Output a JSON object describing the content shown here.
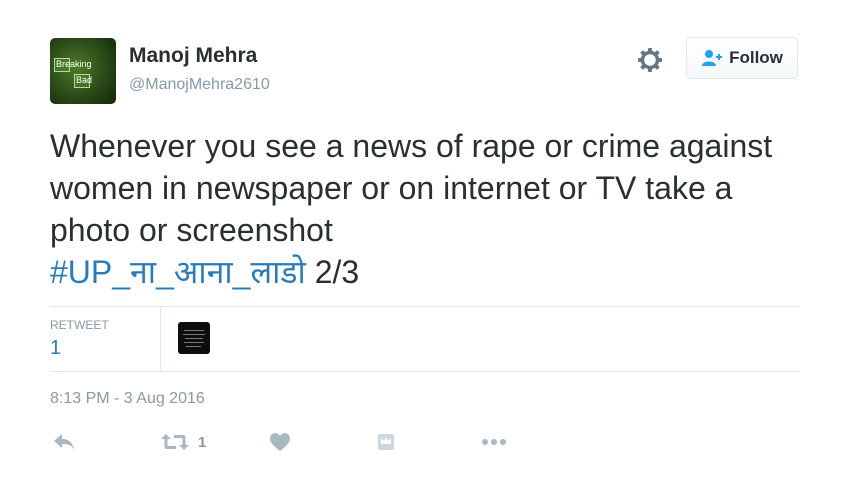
{
  "user": {
    "name": "Manoj Mehra",
    "handle": "@ManojMehra2610",
    "avatar_text_1": "Br",
    "avatar_text_2": "eaking",
    "avatar_text_3": "Ba",
    "avatar_text_4": "d"
  },
  "header": {
    "follow_label": "Follow",
    "gear_icon": "gear-icon",
    "follow_icon": "add-person-icon"
  },
  "tweet": {
    "text": "Whenever you see a news of rape or crime against women in newspaper or on internet or TV take a photo or screenshot",
    "hashtag": "#UP_ना_आना_लाडो",
    "suffix": " 2/3"
  },
  "stats": {
    "retweet_label": "RETWEET",
    "retweet_count": "1"
  },
  "timestamp": "8:13 PM - 3 Aug 2016",
  "actions": {
    "retweet_count": "1",
    "icons": [
      "reply-icon",
      "retweet-icon",
      "heart-icon",
      "moments-icon",
      "more-icon"
    ]
  },
  "colors": {
    "link": "#2b7bb9",
    "muted": "#8899a6",
    "text": "#292f33",
    "border": "#e1e8ed"
  }
}
